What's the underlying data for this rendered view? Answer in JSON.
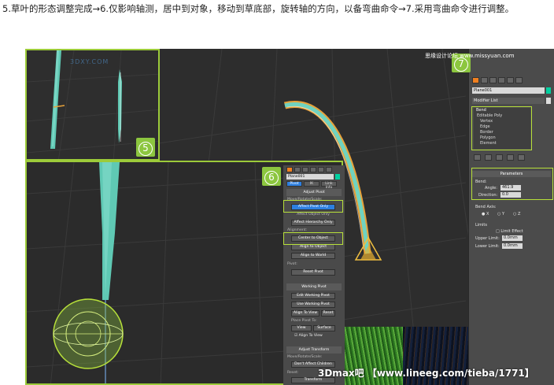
{
  "caption": "5.草叶的形态调整完成→6.仅影响轴测，居中到对象，移动到草底部，旋转轴的方向，以备弯曲命令→7.采用弯曲命令进行调整。",
  "steps": {
    "five": "5",
    "six": "6",
    "seven": "7"
  },
  "site_logo": "3DXY.COM",
  "top_watermark": "思缘设计论坛 www.missyuan.com",
  "bottom_watermark": "3Dmax吧  【www.lineeg.com/tieba/1771】",
  "modify_panel": {
    "object_name": "Plane001",
    "modifier_list": "Modifier List",
    "stack": [
      "Bend",
      "Editable Poly",
      "Vertex",
      "Edge",
      "Border",
      "Polygon",
      "Element"
    ],
    "parameters_title": "Parameters",
    "bend_group": "Bend:",
    "angle_label": "Angle:",
    "angle_value": "461.9",
    "direction_label": "Direction:",
    "direction_value": "0.0",
    "bend_axis_label": "Bend Axis:",
    "axis_x": "X",
    "axis_y": "Y",
    "axis_z": "Z",
    "limits_label": "Limits",
    "limit_effect": "Limit Effect",
    "upper_label": "Upper Limit:",
    "upper_value": "0.0mm",
    "lower_label": "Lower Limit:",
    "lower_value": "0.0mm"
  },
  "hierarchy_panel": {
    "object_name": "Plane001",
    "tabs": [
      "Pivot",
      "IK",
      "Link Info"
    ],
    "adjust_pivot": "Adjust Pivot",
    "move_rotate_scale": "Move/Rotate/Scale:",
    "affect_pivot_only": "Affect Pivot Only",
    "affect_object_only": "Affect Object Only",
    "affect_hierarchy_only": "Affect Hierarchy Only",
    "alignment": "Alignment:",
    "center_to_object": "Center to Object",
    "align_to_object": "Align to Object",
    "align_to_world": "Align to World",
    "pivot": "Pivot:",
    "reset_pivot": "Reset Pivot",
    "working_pivot": "Working Pivot",
    "edit_working_pivot": "Edit Working Pivot",
    "use_working_pivot": "Use Working Pivot",
    "align_to_view": "Align To View",
    "reset": "Reset",
    "place_pivot_to": "Place Pivot To:",
    "view": "View",
    "surface": "Surface",
    "align_to_view_check": "Align To View",
    "adjust_transform": "Adjust Transform",
    "move_rotate_scale_2": "Move/Rotate/Scale:",
    "dont_affect_children": "Don't Affect Children",
    "reset_label": "Reset:",
    "transform": "Transform"
  },
  "colors": {
    "accent": "#8cc63f",
    "highlight": "#b7e03a",
    "active_button": "#2d7fe0",
    "grass": "#5fc9b4"
  }
}
